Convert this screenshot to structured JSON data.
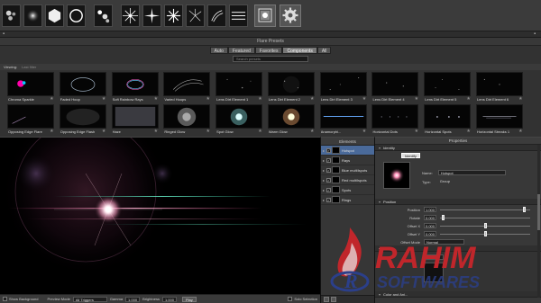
{
  "toolbar": {
    "presets": [
      {
        "icon": "multi-glow-icon"
      },
      {
        "icon": "glow-icon"
      },
      {
        "icon": "hexagon-icon"
      },
      {
        "icon": "ring-icon"
      },
      {
        "icon": "multi-iris-icon"
      },
      {
        "icon": "star-burst-icon"
      },
      {
        "icon": "star-4-icon"
      },
      {
        "icon": "star-8-icon"
      },
      {
        "icon": "spark-icon"
      },
      {
        "icon": "streak-icon"
      },
      {
        "icon": "stripe-icon"
      }
    ],
    "library_icon": "flare-library-icon",
    "settings_icon": "gear-icon"
  },
  "presets_panel": {
    "title": "Flare Presets",
    "filters": [
      "Auto",
      "Featured",
      "Favorites",
      "Components",
      "All"
    ],
    "active_filter": "Components",
    "search_placeholder": "Search presets",
    "viewing_label": "Viewing:",
    "viewing_sub": "Last filter",
    "row1": [
      {
        "name": "Chroma Sparkle"
      },
      {
        "name": "Faded Hoop"
      },
      {
        "name": "Soft Rainbow Rays"
      },
      {
        "name": "Varied Hoops"
      },
      {
        "name": "Lens Dirt Element 1"
      },
      {
        "name": "Lens Dirt Element 2"
      },
      {
        "name": "Lens Dirt Element 3"
      },
      {
        "name": "Lens Dirt Element 4"
      },
      {
        "name": "Lens Dirt Element 5"
      },
      {
        "name": "Lens Dirt Element 6"
      }
    ],
    "row2": [
      {
        "name": "Opposing Edge Flare"
      },
      {
        "name": "Opposing Edge Flash"
      },
      {
        "name": "Haze"
      },
      {
        "name": "Ringed Glow"
      },
      {
        "name": "Spot Glow"
      },
      {
        "name": "Warm Glow"
      },
      {
        "name": "Anamorphi..."
      },
      {
        "name": "Horizontal Dots"
      },
      {
        "name": "Horizontal Spots"
      },
      {
        "name": "Horizontal Streaks 1"
      }
    ]
  },
  "bottom_bar": {
    "show_background": "Show Background",
    "preview_mode_label": "Preview Mode",
    "preview_mode_value": "All Triggers",
    "gamma_label": "Gamma",
    "gamma_value": "1.000",
    "brightness_label": "Brightness",
    "brightness_value": "1.000",
    "play_button": "Play",
    "solo_selection": "Solo Selection"
  },
  "elements_panel": {
    "title": "Elements",
    "items": [
      {
        "label": "Hotspot",
        "checked": "✓",
        "selected": true
      },
      {
        "label": "Rays",
        "checked": "✓",
        "selected": false
      },
      {
        "label": "Blue multiIspots",
        "checked": "✓",
        "selected": false
      },
      {
        "label": "Red multiIspots",
        "checked": "✓",
        "selected": false
      },
      {
        "label": "Spots",
        "checked": "✓",
        "selected": false
      },
      {
        "label": "Rings",
        "checked": "✓",
        "selected": false
      }
    ]
  },
  "properties_panel": {
    "title": "Properties",
    "identity_header": "Identity",
    "identify_button": "Identify",
    "name_label": "Name:",
    "name_value": "Hotspot",
    "type_label": "Type:",
    "type_value": "Group",
    "position_header": "Position",
    "position_rows": [
      {
        "label": "Position",
        "value": "1.000",
        "knob": 0.95
      },
      {
        "label": "Rotate",
        "value": "0.000",
        "knob": 0.02
      },
      {
        "label": "Offset X",
        "value": "0.000",
        "knob": 0.5
      },
      {
        "label": "Offset Y",
        "value": "0.000",
        "knob": 0.5
      }
    ],
    "offset_mode_label": "Offset Mode",
    "offset_mode_value": "Normal",
    "bias_header": "Bias",
    "bias_value": "-0.741",
    "color_header": "Color and Ani..."
  },
  "colors": {
    "selection": "#4a6a9a",
    "watermark_red": "#c0262b",
    "watermark_blue": "#2b3f8a"
  },
  "watermark": {
    "big": "RAHIM",
    "small": "SOFTWARES",
    "letter": "R"
  }
}
